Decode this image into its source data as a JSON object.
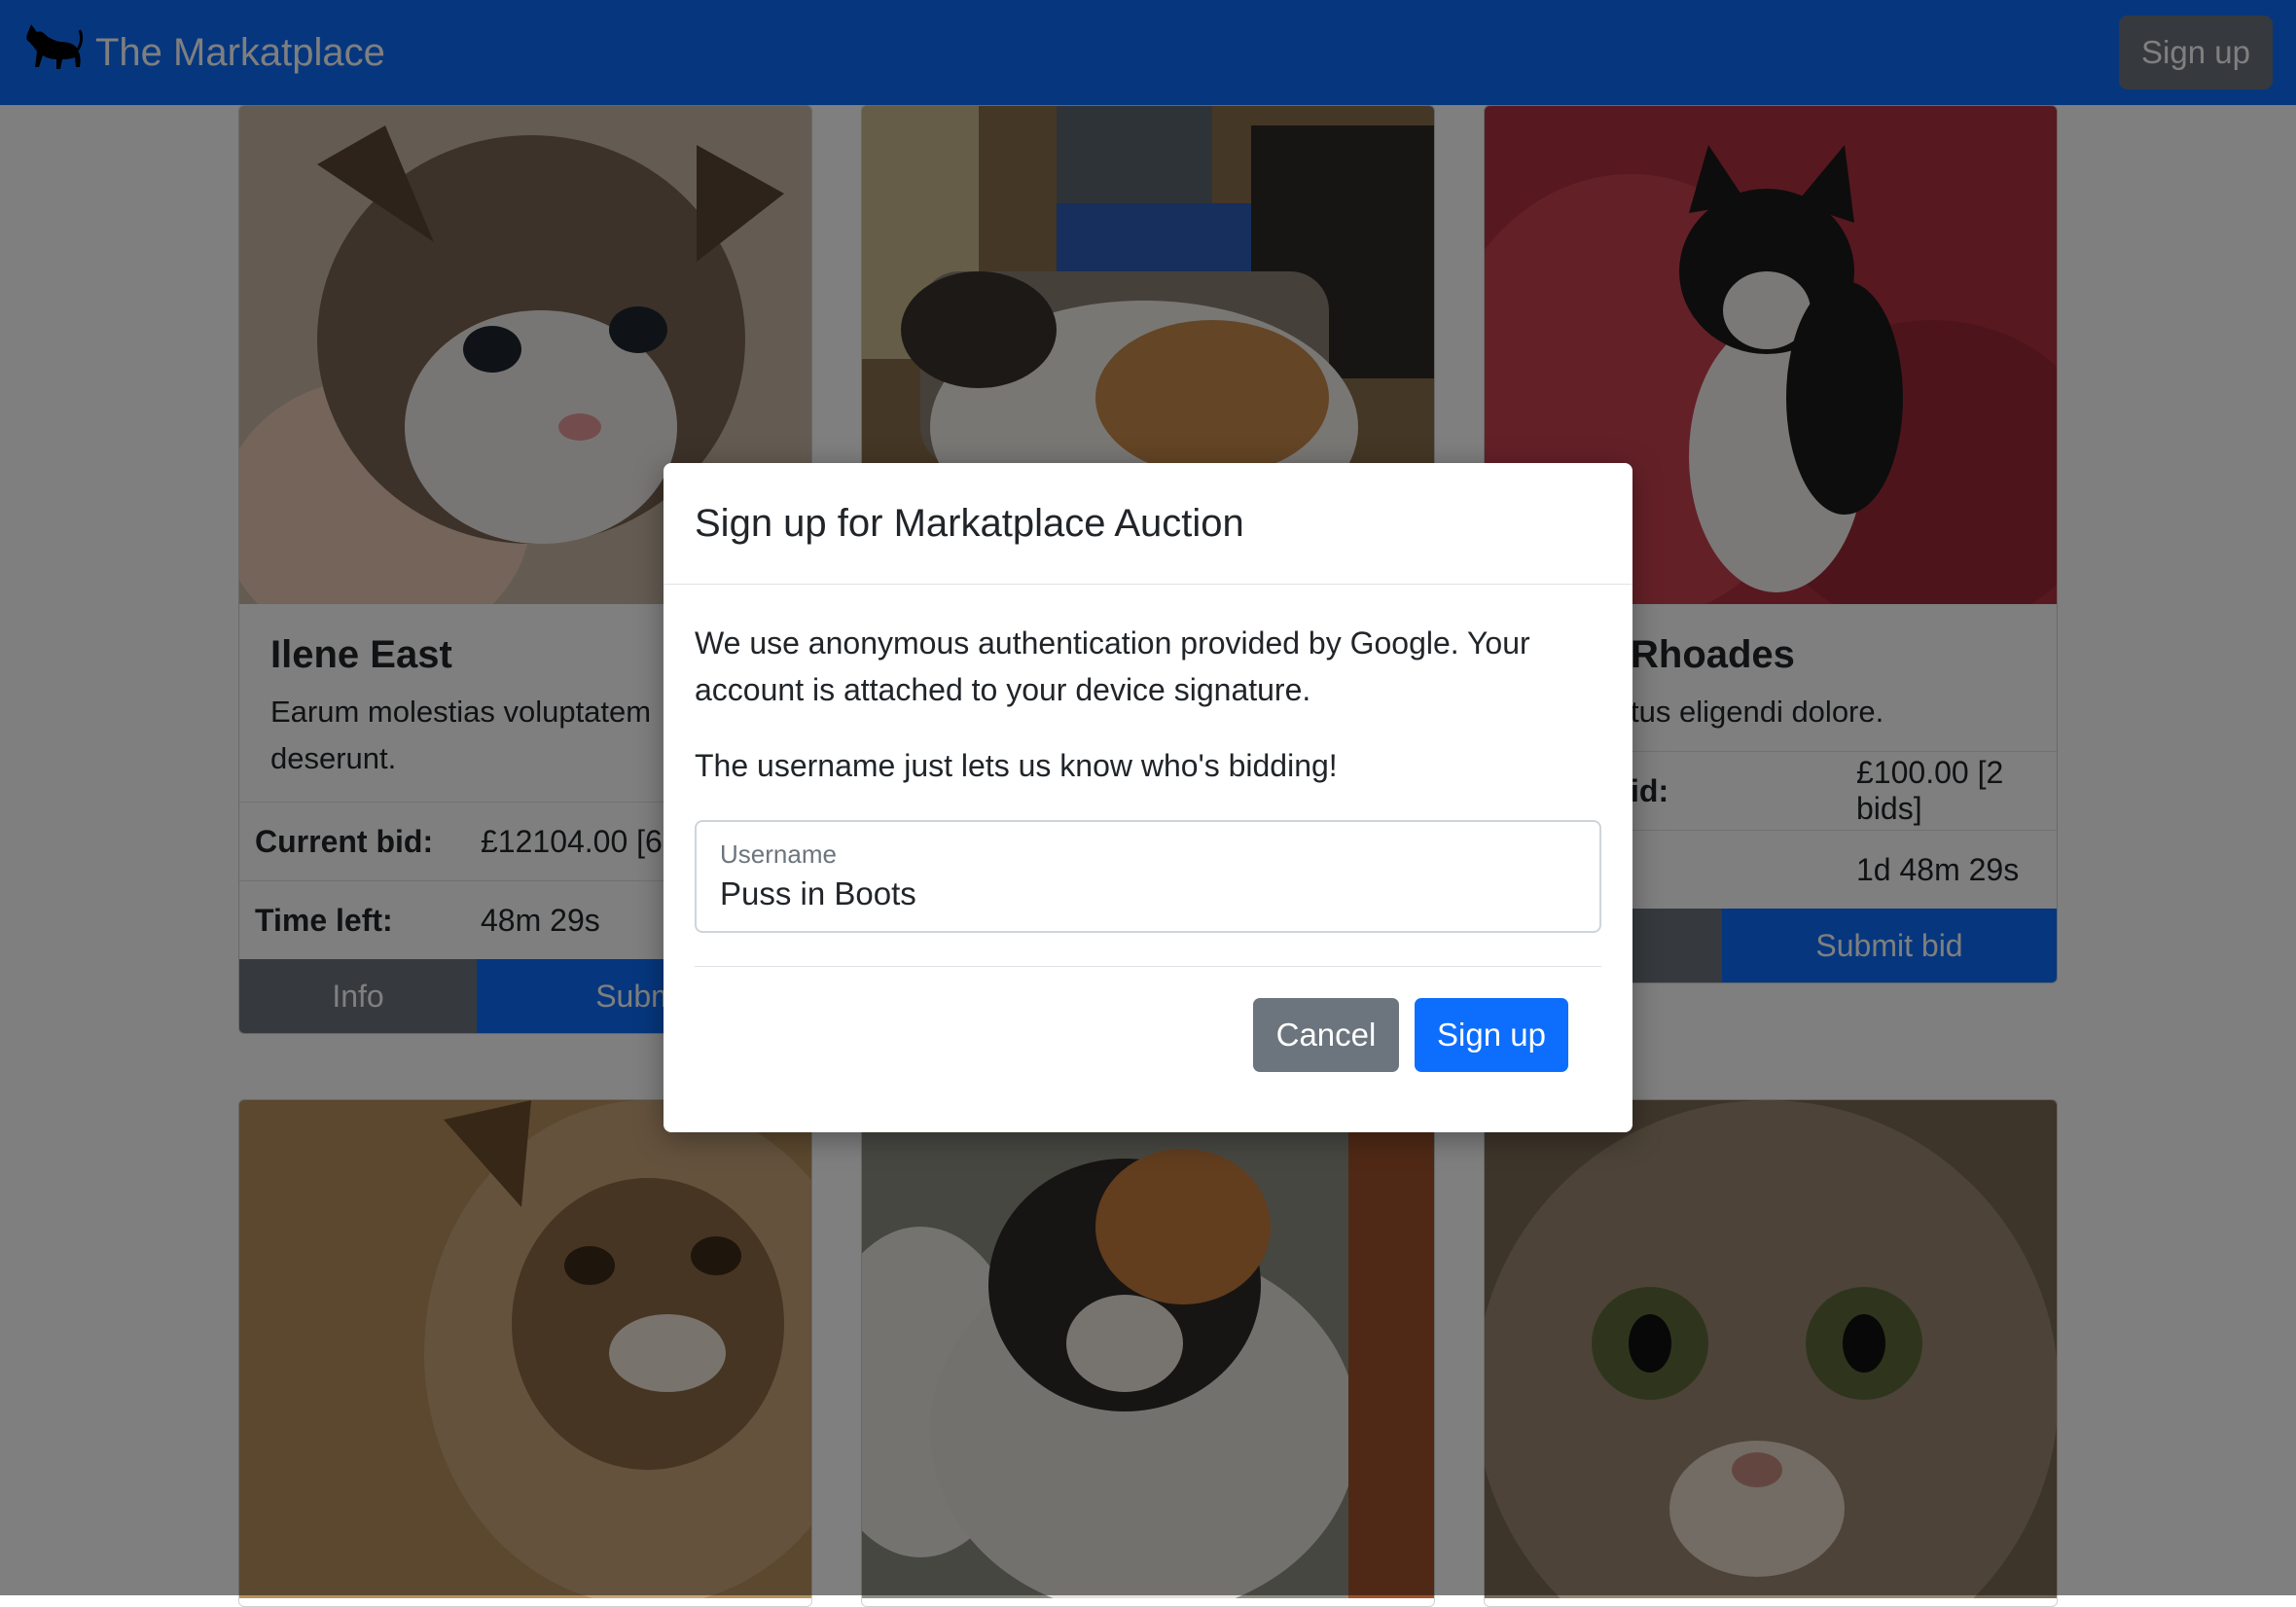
{
  "navbar": {
    "brand": "The Markatplace",
    "brand_icon": "cat-icon",
    "signup_label": "Sign up",
    "bg_color": "#0d6efd"
  },
  "cards": [
    {
      "name": "Ilene East",
      "description": "Earum molestias voluptatem deserunt.",
      "current_bid_label": "Current bid:",
      "current_bid": "£12104.00 [6",
      "time_left_label": "Time left:",
      "time_left": "48m 29s",
      "info_label": "Info",
      "submit_label": "Submit"
    },
    {
      "name": "Rhoades",
      "description": "tus eligendi dolore.",
      "current_bid_label": "id:",
      "current_bid": "£100.00 [2 bids]",
      "time_left_label": "",
      "time_left": "1d 48m 29s",
      "info_label": "",
      "submit_label": "Submit bid"
    }
  ],
  "modal": {
    "title": "Sign up for Markatplace Auction",
    "paragraph1": "We use anonymous authentication provided by Google. Your account is attached to your device signature.",
    "paragraph2": "The username just lets us know who's bidding!",
    "username_label": "Username",
    "username_value": "Puss in Boots",
    "cancel_label": "Cancel",
    "signup_label": "Sign up"
  },
  "colors": {
    "primary": "#0d6efd",
    "secondary": "#6c757d",
    "backdrop": "rgba(0,0,0,0.5)"
  }
}
